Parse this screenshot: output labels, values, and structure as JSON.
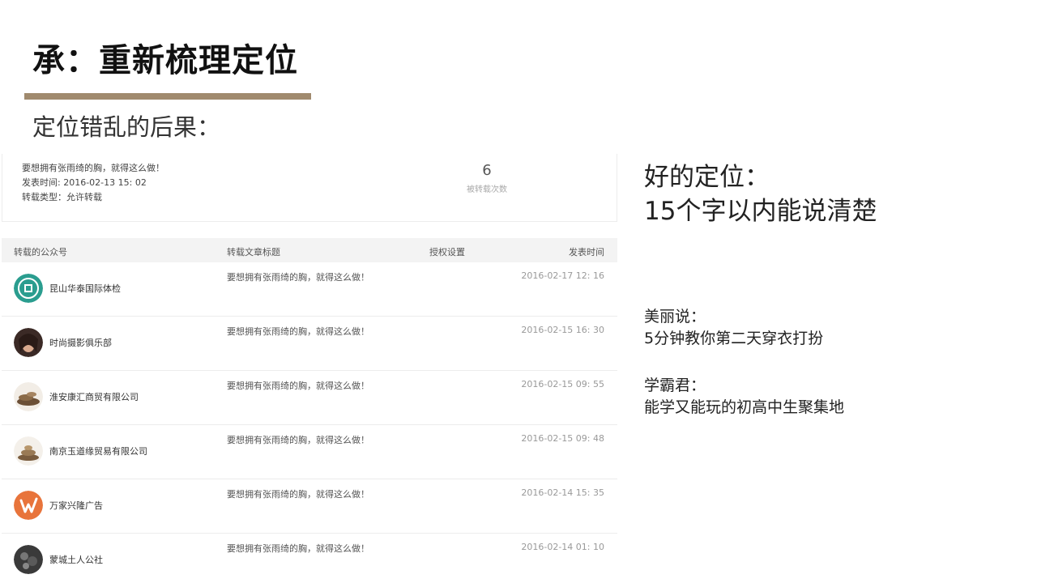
{
  "slide": {
    "title": "承：重新梳理定位",
    "subtitle": "定位错乱的后果：",
    "accent_color": "#a08a6e"
  },
  "summary": {
    "article_title": "要想拥有张雨绮的胸，就得这么做！",
    "publish_time": "发表时间: 2016-02-13 15: 02",
    "repost_type": "转载类型：允许转载",
    "repost_count": "6",
    "repost_count_label": "被转载次数"
  },
  "table": {
    "headers": {
      "account": "转载的公众号",
      "title": "转载文章标题",
      "auth": "授权设置",
      "time": "发表时间"
    },
    "rows": [
      {
        "account": "昆山华泰国际体检",
        "title": "要想拥有张雨绮的胸，就得这么做！",
        "time": "2016-02-17 12: 16",
        "avatar_icon": "green-emblem-icon"
      },
      {
        "account": "时尚摄影俱乐部",
        "title": "要想拥有张雨绮的胸，就得这么做！",
        "time": "2016-02-15 16: 30",
        "avatar_icon": "portrait-icon"
      },
      {
        "account": "淮安康汇商贸有限公司",
        "title": "要想拥有张雨绮的胸，就得这么做！",
        "time": "2016-02-15 09: 55",
        "avatar_icon": "product-icon"
      },
      {
        "account": "南京玉道缘贸易有限公司",
        "title": "要想拥有张雨绮的胸，就得这么做！",
        "time": "2016-02-15 09: 48",
        "avatar_icon": "product-icon"
      },
      {
        "account": "万家兴隆广告",
        "title": "要想拥有张雨绮的胸，就得这么做！",
        "time": "2016-02-14 15: 35",
        "avatar_icon": "orange-logo-icon"
      },
      {
        "account": "蒙城土人公社",
        "title": "要想拥有张雨绮的胸，就得这么做！",
        "time": "2016-02-14 01: 10",
        "avatar_icon": "dark-photo-icon"
      }
    ]
  },
  "right": {
    "heading_line1": "好的定位：",
    "heading_line2": "15个字以内能说清楚",
    "example1_name": "美丽说：",
    "example1_desc": "5分钟教你第二天穿衣打扮",
    "example2_name": "学霸君：",
    "example2_desc": "能学又能玩的初高中生聚集地"
  }
}
